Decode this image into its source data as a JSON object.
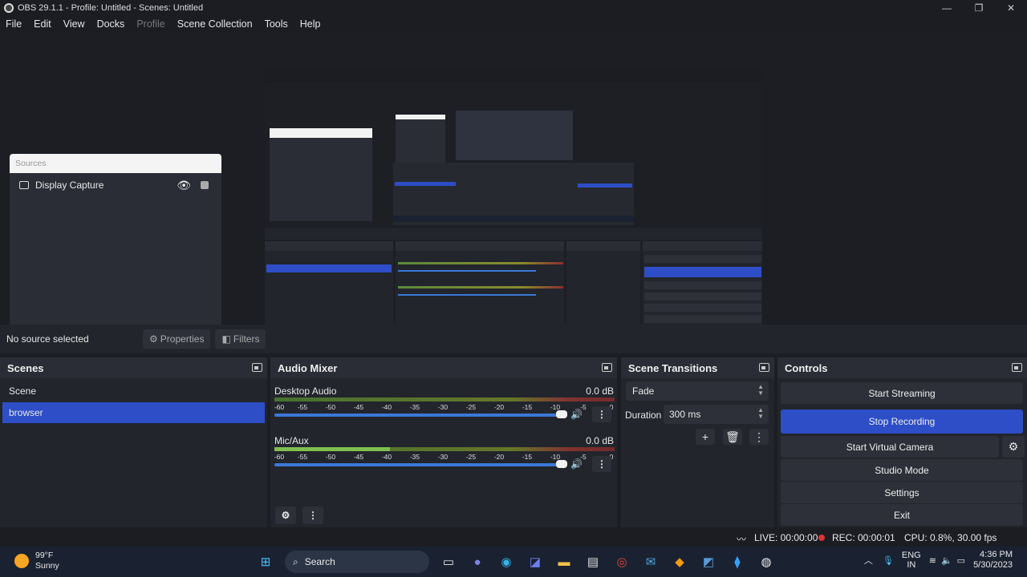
{
  "window": {
    "title": "OBS 29.1.1 - Profile: Untitled - Scenes: Untitled",
    "controls": [
      "—",
      "❐",
      "✕"
    ]
  },
  "menu": [
    "File",
    "Edit",
    "View",
    "Docks",
    "Profile",
    "Scene Collection",
    "Tools",
    "Help"
  ],
  "sources_panel": {
    "header": "Sources",
    "item": "Display Capture"
  },
  "source_toolbar": {
    "status": "No source selected",
    "properties": "Properties",
    "filters": "Filters"
  },
  "scenes": {
    "title": "Scenes",
    "items": [
      "Scene",
      "browser"
    ],
    "selected_index": 1
  },
  "audio_mixer": {
    "title": "Audio Mixer",
    "channels": [
      {
        "name": "Desktop Audio",
        "db": "0.0 dB",
        "level": 0
      },
      {
        "name": "Mic/Aux",
        "db": "0.0 dB",
        "level": 0.34
      }
    ],
    "ticks": [
      "-60",
      "-55",
      "-50",
      "-45",
      "-40",
      "-35",
      "-30",
      "-25",
      "-20",
      "-15",
      "-10",
      "-5",
      "0"
    ]
  },
  "scene_transitions": {
    "title": "Scene Transitions",
    "transition": "Fade",
    "duration_label": "Duration",
    "duration": "300 ms"
  },
  "controls": {
    "title": "Controls",
    "start_streaming": "Start Streaming",
    "stop_recording": "Stop Recording",
    "start_virtual_camera": "Start Virtual Camera",
    "studio_mode": "Studio Mode",
    "settings": "Settings",
    "exit": "Exit"
  },
  "status": {
    "live": "LIVE: 00:00:00",
    "rec": "REC: 00:00:01",
    "cpu": "CPU: 0.8%, 30.00 fps"
  },
  "taskbar": {
    "weather_temp": "99°F",
    "weather_desc": "Sunny",
    "search": "Search",
    "lang_top": "ENG",
    "lang_bottom": "IN",
    "time": "4:36 PM",
    "date": "5/30/2023"
  },
  "colors": {
    "accent": "#2d4ec7",
    "background": "#1c1e24",
    "panel": "#22252c",
    "recording": "#d33333"
  }
}
